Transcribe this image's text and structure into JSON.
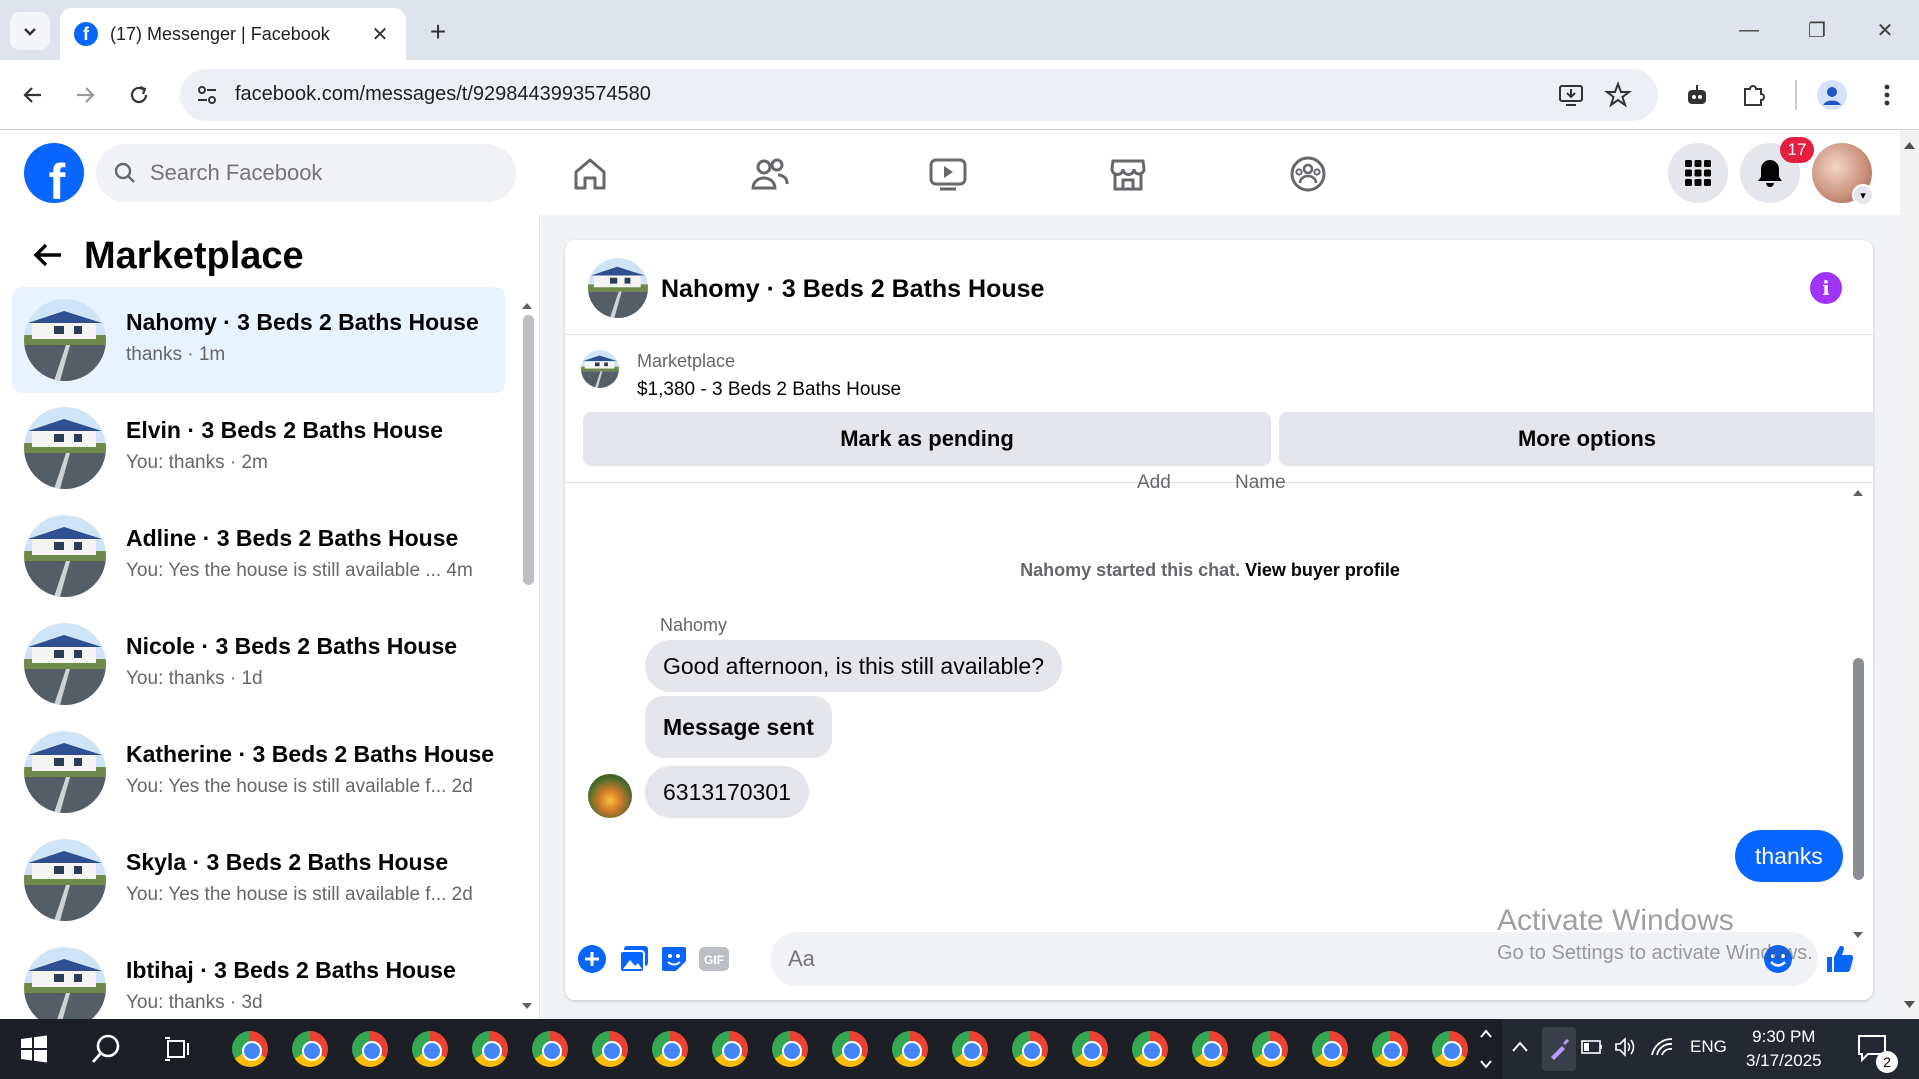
{
  "browser": {
    "tab_title": "(17) Messenger | Facebook",
    "url": "facebook.com/messages/t/9298443993574580"
  },
  "fb": {
    "search_placeholder": "Search Facebook",
    "notification_count": "17"
  },
  "left_panel": {
    "title": "Marketplace",
    "conversations": [
      {
        "name": "Nahomy · 3 Beds 2 Baths House",
        "snippet": "thanks · 1m",
        "active": true
      },
      {
        "name": "Elvin · 3 Beds 2 Baths House",
        "snippet": "You: thanks · 2m"
      },
      {
        "name": "Adline · 3 Beds 2 Baths House",
        "snippet": "You: Yes the house is still available ...  4m"
      },
      {
        "name": "Nicole · 3 Beds 2 Baths House",
        "snippet": "You: thanks · 1d"
      },
      {
        "name": "Katherine · 3 Beds 2 Baths House",
        "snippet": "You: Yes the house is still available f...  2d"
      },
      {
        "name": "Skyla · 3 Beds 2 Baths House",
        "snippet": "You: Yes the house is still available f...  2d"
      },
      {
        "name": "Ibtihaj · 3 Beds 2 Baths House",
        "snippet": "You: thanks · 3d"
      }
    ]
  },
  "chat": {
    "title": "Nahomy · 3 Beds 2 Baths House",
    "listing_label": "Marketplace",
    "listing_title": "$1,380 - 3 Beds 2 Baths House",
    "mark_pending": "Mark as pending",
    "more_options": "More options",
    "cut_label_1": "Add",
    "cut_label_2": "Name",
    "started_text": "Nahomy started this chat.",
    "view_profile": "View buyer profile",
    "sender": "Nahomy",
    "messages_in": [
      "Good afternoon, is this still available?",
      "Message sent",
      "6313170301"
    ],
    "message_out": "thanks",
    "input_placeholder": "Aa"
  },
  "watermark": {
    "line1": "Activate Windows",
    "line2": "Go to Settings to activate Windows."
  },
  "taskbar": {
    "time": "9:30 PM",
    "date": "3/17/2025",
    "lang": "ENG",
    "notif_count": "2"
  },
  "colors": {
    "fb_blue": "#0866ff",
    "active_conv": "#e7f3ff",
    "badge_red": "#e41e3f",
    "info_purple": "#a033ff"
  }
}
